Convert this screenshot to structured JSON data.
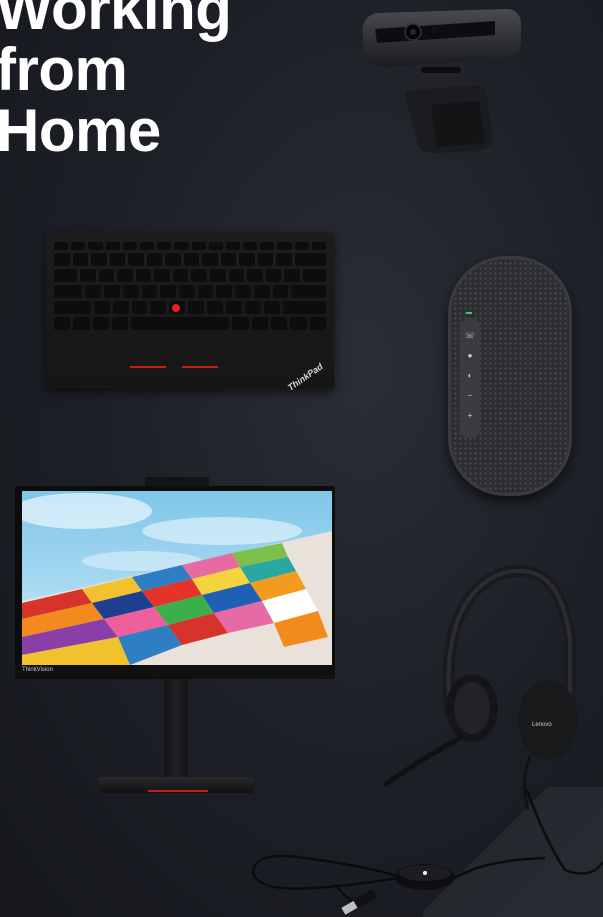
{
  "headline": {
    "line1": "Working",
    "line2": "from",
    "line3": "Home"
  },
  "products": {
    "keyboard_brand": "ThinkPad",
    "monitor_brand": "ThinkVision",
    "headset_brand": "Lenovo"
  },
  "colors": {
    "background": "#1c1f26",
    "headline": "#ffffff",
    "accent_red": "#e2231a",
    "speaker_led": "#2dd36f"
  }
}
